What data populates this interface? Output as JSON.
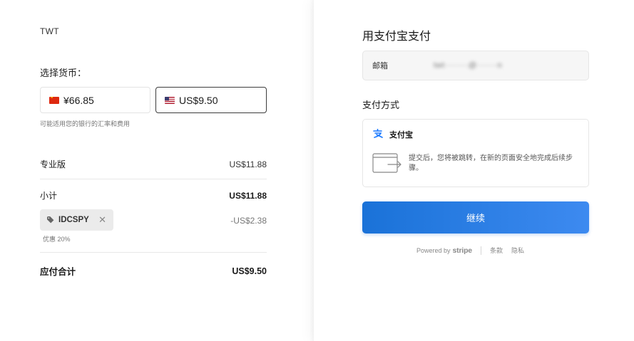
{
  "merchant": {
    "name": "TWT"
  },
  "currency": {
    "label": "选择货币：",
    "options": [
      {
        "flag": "cn-flag",
        "amount": "¥66.85",
        "selected": false
      },
      {
        "flag": "us-flag",
        "amount": "US$9.50",
        "selected": true
      }
    ],
    "rate_note": "可能适用您的银行的汇率和费用"
  },
  "summary": {
    "items": [
      {
        "label": "专业版",
        "value": "US$11.88"
      }
    ],
    "subtotal": {
      "label": "小计",
      "value": "US$11.88"
    },
    "coupon": {
      "code": "IDCSPY",
      "discount": "-US$2.38",
      "note": "优惠 20%"
    },
    "total": {
      "label": "应付合计",
      "value": "US$9.50"
    }
  },
  "payment": {
    "title": "用支付宝支付",
    "email": {
      "label": "邮箱",
      "value": "twt········@·······n"
    },
    "method_label": "支付方式",
    "method": {
      "name": "支付宝",
      "logo": "支",
      "instructions": "提交后，您将被跳转，在新的页面安全地完成后续步骤。"
    },
    "continue_label": "继续"
  },
  "footer": {
    "powered_by": "Powered by",
    "brand": "stripe",
    "links": [
      "条款",
      "隐私"
    ]
  },
  "colors": {
    "button_start": "#1a72d8",
    "button_end": "#3d8af0",
    "alipay_blue": "#1677ff"
  }
}
